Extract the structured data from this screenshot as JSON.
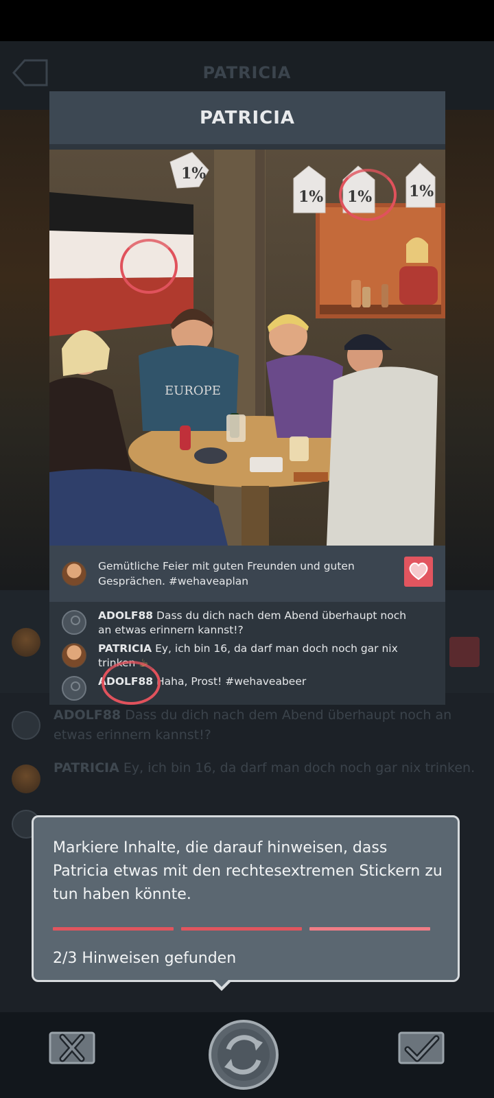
{
  "background": {
    "title": "PATRICIA",
    "comments": [
      {
        "user": "ADOLF88",
        "text": "Dass du dich nach dem Abend überhaupt noch an etwas erinnern kannst!?"
      },
      {
        "user": "PATRICIA",
        "text": "Ey, ich bin 16, da darf man doch noch gar nix trinken."
      }
    ]
  },
  "post": {
    "title": "PATRICIA",
    "caption": "Gemütliche Feier mit guten Freunden und guten Gesprächen. #wehaveaplan",
    "image_texts": {
      "sticker": "1%",
      "shirt": "EUROPE"
    },
    "comments": [
      {
        "user": "ADOLF88",
        "text": "Dass du dich nach dem Abend überhaupt noch an etwas erinnern kannst!?",
        "avatar": "default-user-icon"
      },
      {
        "user": "PATRICIA",
        "text": "Ey, ich bin 16, da darf man doch noch gar nix trinken",
        "avatar": "patricia-avatar"
      },
      {
        "user": "ADOLF88",
        "text": "Haha, Prost! #wehaveabeer",
        "avatar": "default-user-icon"
      }
    ]
  },
  "hint": {
    "instruction": "Markiere Inhalte, die darauf hinweisen, dass Patricia etwas mit den rechtesextremen Stickern zu tun haben könnte.",
    "progress_found": 2,
    "progress_total": 3,
    "status": "2/3 Hinweisen gefunden"
  },
  "toolbar": {
    "icons": [
      "close-icon",
      "refresh-icon",
      "check-icon"
    ]
  },
  "colors": {
    "accent": "#e0555e",
    "panel": "#3d4853",
    "dialog": "#5b6771"
  }
}
